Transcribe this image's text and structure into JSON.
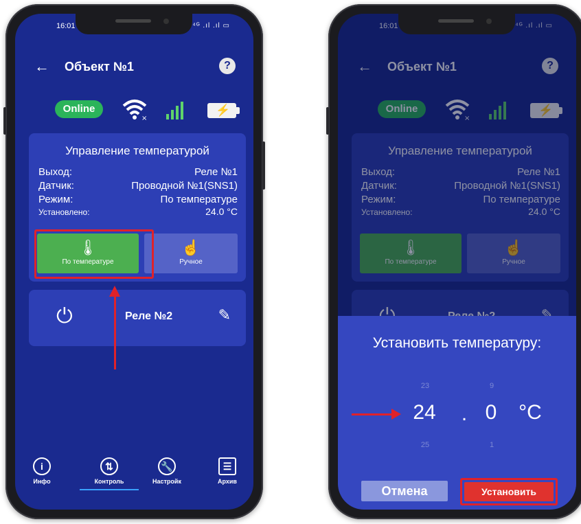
{
  "status": {
    "time": "16:01",
    "icons": "⁴ᴳ .ıl .ıl ▭"
  },
  "header": {
    "back": "←",
    "title": "Объект №1",
    "help": "?"
  },
  "indicators": {
    "online_label": "Online"
  },
  "control": {
    "title": "Управление температурой",
    "output_label": "Выход:",
    "output_value": "Реле №1",
    "sensor_label": "Датчик:",
    "sensor_value": "Проводной №1(SNS1)",
    "mode_label": "Режим:",
    "mode_value": "По температуре",
    "set_label": "Установлено:",
    "set_value": "24.0 °C",
    "auto_btn": "По температуре",
    "manual_btn": "Ручное"
  },
  "relay": {
    "name": "Реле №2"
  },
  "nav": {
    "info": "Инфо",
    "control": "Контроль",
    "settings": "Настройк",
    "archive": "Архив"
  },
  "dialog": {
    "title": "Установить температуру:",
    "int_prev": "23",
    "int_value": "24",
    "int_next": "25",
    "dot": ".",
    "frac_prev": "9",
    "frac_value": "0",
    "frac_next": "1",
    "unit": "°C",
    "cancel": "Отмена",
    "confirm": "Установить"
  },
  "colors": {
    "background": "#1a2a8f",
    "card": "#2d3fb5",
    "online": "#2bb45a",
    "auto_mode": "#4caf50",
    "highlight": "#e0222a",
    "confirm": "#e0322e"
  }
}
